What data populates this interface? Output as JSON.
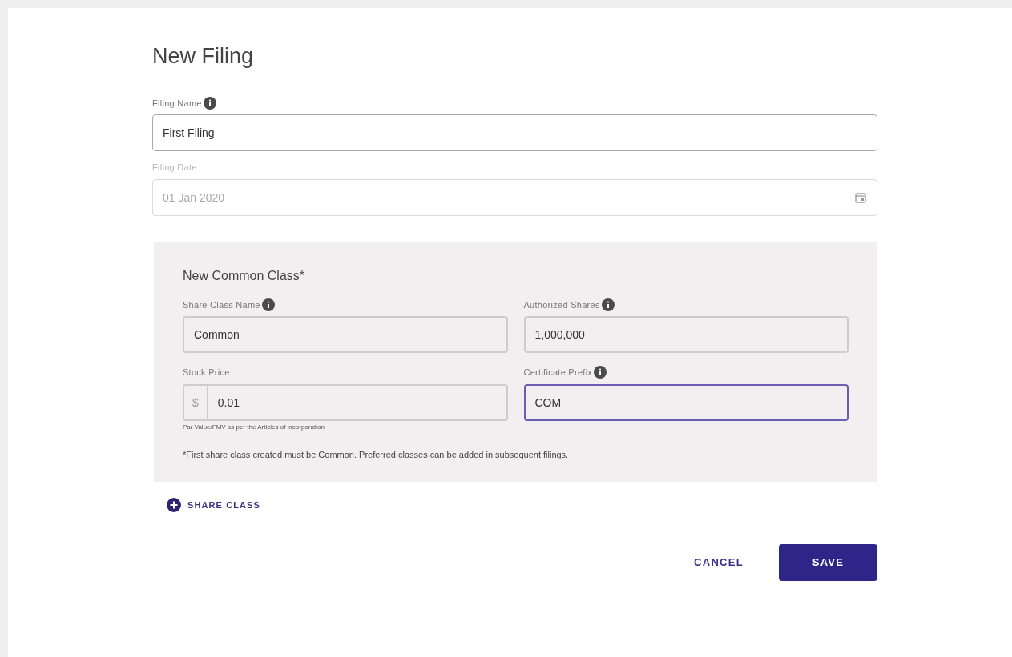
{
  "title": "New Filing",
  "fields": [
    {
      "label": "Filing Name",
      "info": true,
      "value": "First Filing",
      "disabled": false,
      "focused": false,
      "kind": "text"
    },
    {
      "label": "Filing Date",
      "info": false,
      "value": "01 Jan 2020",
      "disabled": true,
      "focused": false,
      "kind": "date"
    }
  ],
  "share_class": {
    "title": "New Common Class*",
    "fields": [
      {
        "label": "Share Class Name",
        "info": true,
        "value": "Common",
        "focused": false
      },
      {
        "label": "Authorized Shares",
        "info": true,
        "value": "1,000,000",
        "focused": false
      },
      {
        "label": "Stock Price",
        "info": false,
        "prefix": "$",
        "value": "0.01",
        "helper": "Par Value/FMV as per the Articles of incorporation",
        "focused": false
      },
      {
        "label": "Certificate Prefix",
        "info": true,
        "value": "COM",
        "focused": true
      }
    ],
    "note": "*First share class created must be Common. Preferred classes can be added in subsequent filings."
  },
  "add_button": "SHARE CLASS",
  "buttons": [
    {
      "label": "CANCEL",
      "kind": "text"
    },
    {
      "label": "SAVE",
      "kind": "primary"
    }
  ]
}
